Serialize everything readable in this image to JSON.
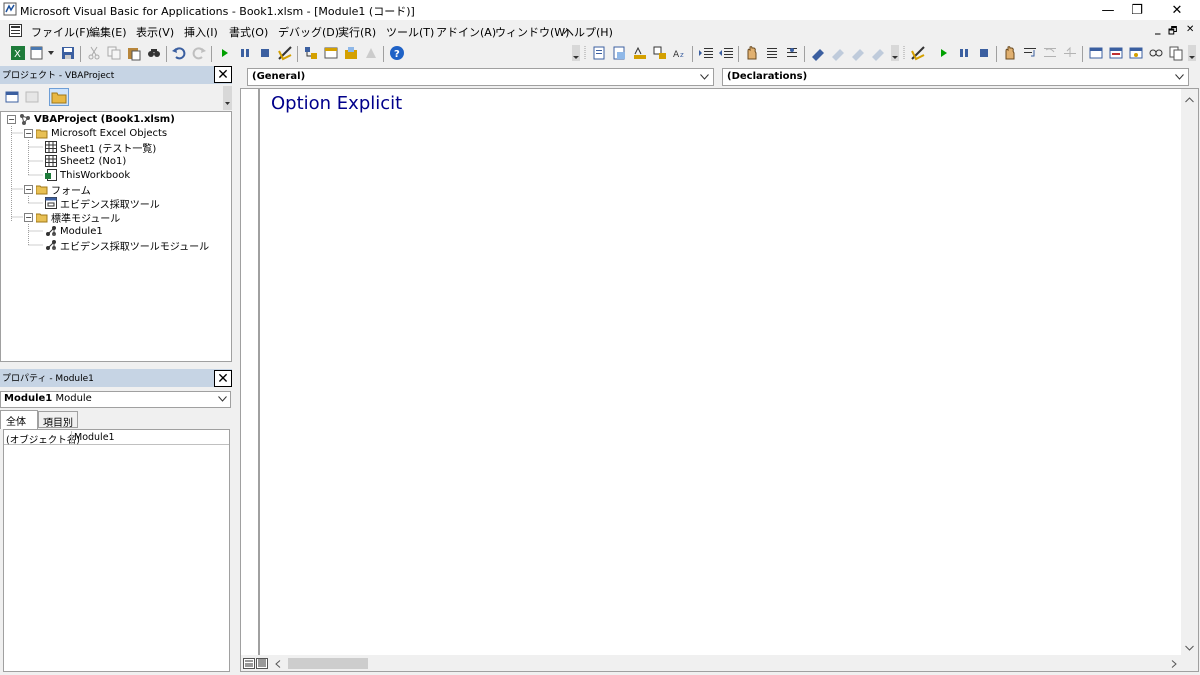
{
  "window": {
    "title": "Microsoft Visual Basic for Applications - Book1.xlsm - [Module1 (コード)]",
    "minimize": "—",
    "restore": "❐",
    "close": "✕"
  },
  "menubar": {
    "items": [
      "ファイル(F)",
      "編集(E)",
      "表示(V)",
      "挿入(I)",
      "書式(O)",
      "デバッグ(D)",
      "実行(R)",
      "ツール(T)",
      "アドイン(A)",
      "ウィンドウ(W)",
      "ヘルプ(H)"
    ],
    "child_min": "_",
    "child_restore": "🗗",
    "child_close": "✕"
  },
  "project_panel": {
    "title": "プロジェクト - VBAProject",
    "tree": {
      "root": "VBAProject (Book1.xlsm)",
      "folders": [
        {
          "label": "Microsoft Excel Objects",
          "items": [
            "Sheet1 (テスト一覧)",
            "Sheet2 (No1)",
            "ThisWorkbook"
          ]
        },
        {
          "label": "フォーム",
          "items": [
            "エビデンス採取ツール"
          ]
        },
        {
          "label": "標準モジュール",
          "items": [
            "Module1",
            "エビデンス採取ツールモジュール"
          ]
        }
      ]
    }
  },
  "properties_panel": {
    "title": "プロパティ - Module1",
    "object_name": "Module1",
    "object_type": "Module",
    "tabs": [
      "全体",
      "項目別"
    ],
    "rows": [
      {
        "name": "(オブジェクト名)",
        "value": "Module1"
      }
    ]
  },
  "code_window": {
    "object_combo": "(General)",
    "procedure_combo": "(Declarations)",
    "code": "Option Explicit"
  },
  "colors": {
    "panel_header": "#c6d4e4",
    "code_text": "#00008b",
    "run_green": "#00a000"
  }
}
